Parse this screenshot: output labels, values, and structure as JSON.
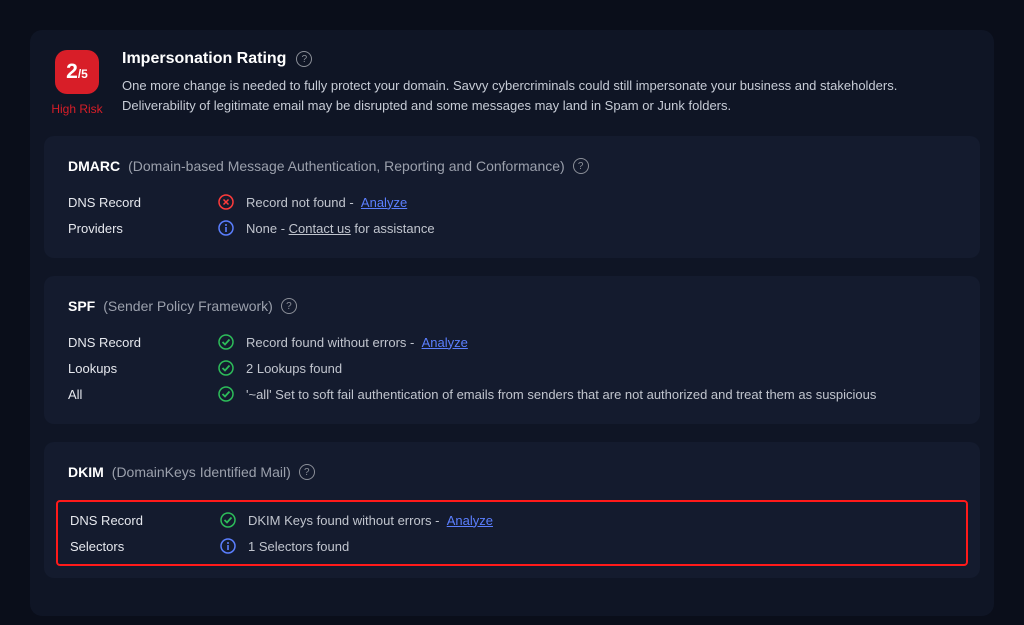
{
  "header": {
    "score_num": "2",
    "score_denom": "/5",
    "risk_label": "High Risk",
    "title": "Impersonation Rating",
    "description": "One more change is needed to fully protect your domain. Savvy cybercriminals could still impersonate your business and stakeholders. Deliverability of legitimate email may be disrupted and some messages may land in Spam or Junk folders."
  },
  "dmarc": {
    "name": "DMARC",
    "expansion": "(Domain-based Message Authentication, Reporting and Conformance)",
    "dns_label": "DNS Record",
    "dns_text": "Record not found -",
    "dns_link": "Analyze",
    "providers_label": "Providers",
    "providers_prefix": "None - ",
    "providers_link": "Contact us",
    "providers_suffix": " for assistance"
  },
  "spf": {
    "name": "SPF",
    "expansion": "(Sender Policy Framework)",
    "dns_label": "DNS Record",
    "dns_text": "Record found without errors -",
    "dns_link": "Analyze",
    "lookups_label": "Lookups",
    "lookups_text": "2 Lookups found",
    "all_label": "All",
    "all_text": "'~all' Set to soft fail authentication of emails from senders that are not authorized and treat them as suspicious"
  },
  "dkim": {
    "name": "DKIM",
    "expansion": "(DomainKeys Identified Mail)",
    "dns_label": "DNS Record",
    "dns_text": "DKIM Keys found without errors -",
    "dns_link": "Analyze",
    "selectors_label": "Selectors",
    "selectors_text": "1 Selectors found"
  }
}
